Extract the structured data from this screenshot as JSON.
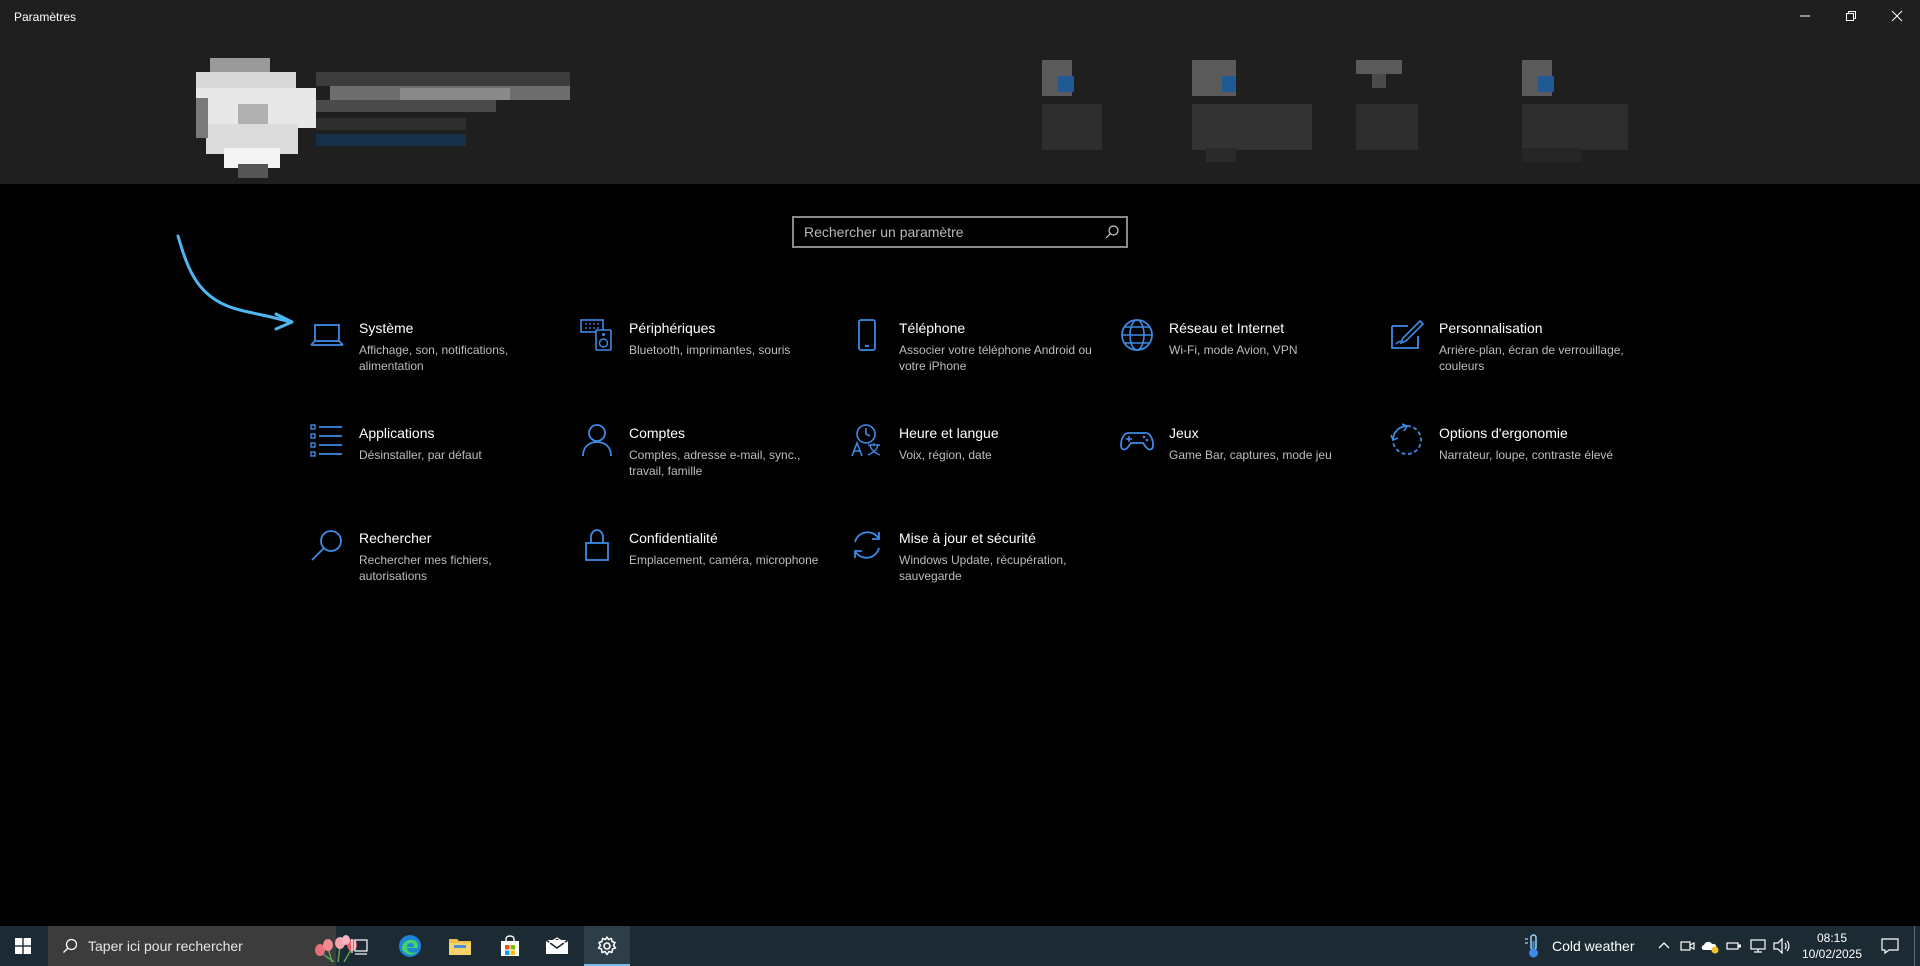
{
  "window": {
    "title": "Paramètres",
    "controls": [
      "minimize-icon",
      "restore-icon",
      "close-icon"
    ]
  },
  "search": {
    "placeholder": "Rechercher un paramètre"
  },
  "categories": [
    {
      "name": "Système",
      "desc": "Affichage, son, notifications, alimentation",
      "icon": "laptop-icon"
    },
    {
      "name": "Périphériques",
      "desc": "Bluetooth, imprimantes, souris",
      "icon": "keyboard-speaker-icon"
    },
    {
      "name": "Téléphone",
      "desc": "Associer votre téléphone Android ou votre iPhone",
      "icon": "phone-icon"
    },
    {
      "name": "Réseau et Internet",
      "desc": "Wi-Fi, mode Avion, VPN",
      "icon": "globe-icon"
    },
    {
      "name": "Personnalisation",
      "desc": "Arrière-plan, écran de verrouillage, couleurs",
      "icon": "paint-tablet-icon"
    },
    {
      "name": "Applications",
      "desc": "Désinstaller, par défaut",
      "icon": "apps-list-icon"
    },
    {
      "name": "Comptes",
      "desc": "Comptes, adresse e-mail, sync., travail, famille",
      "icon": "person-icon"
    },
    {
      "name": "Heure et langue",
      "desc": "Voix, région, date",
      "icon": "time-language-icon"
    },
    {
      "name": "Jeux",
      "desc": "Game Bar, captures, mode jeu",
      "icon": "gamepad-icon"
    },
    {
      "name": "Options d'ergonomie",
      "desc": "Narrateur, loupe, contraste élevé",
      "icon": "ease-of-access-icon"
    },
    {
      "name": "Rechercher",
      "desc": "Rechercher mes fichiers, autorisations",
      "icon": "search-icon"
    },
    {
      "name": "Confidentialité",
      "desc": "Emplacement, caméra, microphone",
      "icon": "lock-icon"
    },
    {
      "name": "Mise à jour et sécurité",
      "desc": "Windows Update, récupération, sauvegarde",
      "icon": "sync-icon"
    }
  ],
  "taskbar": {
    "search_placeholder": "Taper ici pour rechercher",
    "weather": "Cold weather",
    "time": "08:15",
    "date": "10/02/2025"
  },
  "colors": {
    "accent": "#3d8be6",
    "annotation_arrow": "#4fb6f0",
    "header_bg": "#1f1f1f",
    "taskbar_bg": "#1c2a33"
  }
}
